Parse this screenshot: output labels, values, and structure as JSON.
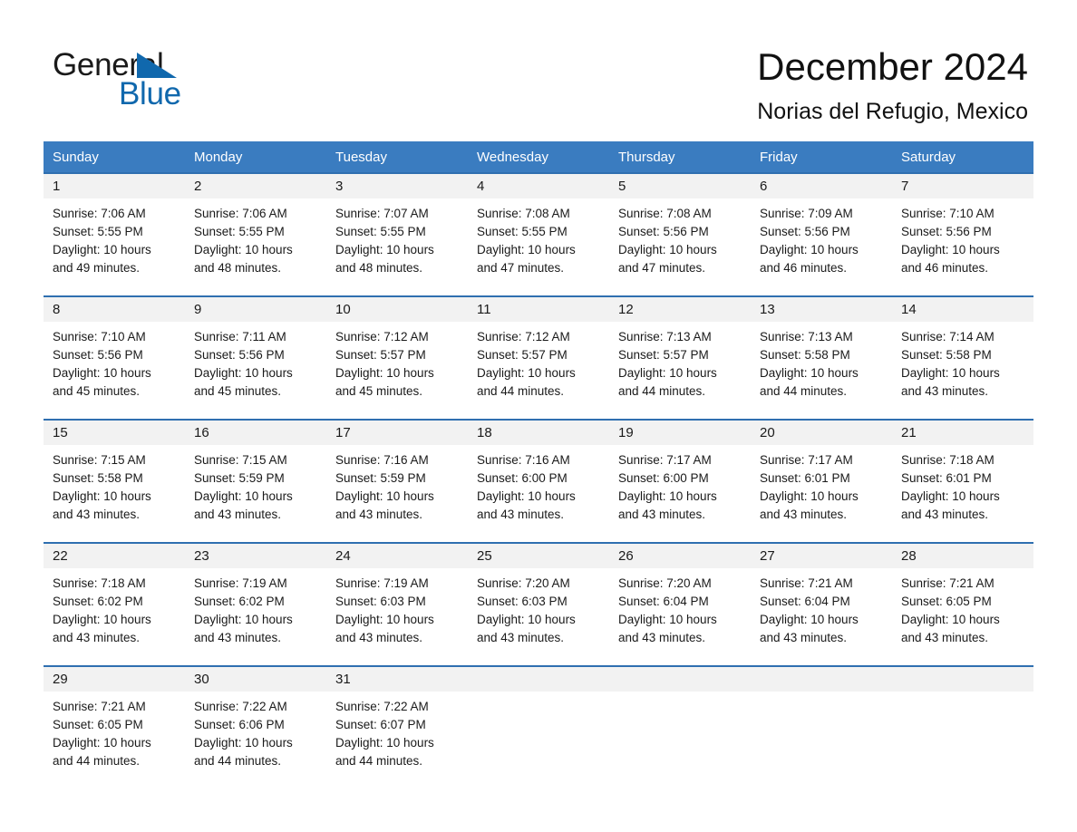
{
  "brand": {
    "name_part1": "General",
    "name_part2": "Blue",
    "triangle_color": "#1068ad",
    "logo_icon": "triangle-flag-icon"
  },
  "header": {
    "title": "December 2024",
    "subtitle": "Norias del Refugio, Mexico"
  },
  "theme": {
    "header_blue": "#3a7cc0",
    "rule_blue": "#2f6fb0",
    "daynum_band": "#f2f2f2",
    "text": "#1a1a1a",
    "page_background": "#ffffff"
  },
  "calendar": {
    "month": "December",
    "year": "2024",
    "weekday_headers": [
      "Sunday",
      "Monday",
      "Tuesday",
      "Wednesday",
      "Thursday",
      "Friday",
      "Saturday"
    ],
    "labels": {
      "sunrise_prefix": "Sunrise:",
      "sunset_prefix": "Sunset:",
      "daylight_prefix": "Daylight:"
    },
    "weeks": [
      [
        {
          "day": "1",
          "sunrise": "Sunrise: 7:06 AM",
          "sunset": "Sunset: 5:55 PM",
          "daylight_line1": "Daylight: 10 hours",
          "daylight_line2": "and 49 minutes."
        },
        {
          "day": "2",
          "sunrise": "Sunrise: 7:06 AM",
          "sunset": "Sunset: 5:55 PM",
          "daylight_line1": "Daylight: 10 hours",
          "daylight_line2": "and 48 minutes."
        },
        {
          "day": "3",
          "sunrise": "Sunrise: 7:07 AM",
          "sunset": "Sunset: 5:55 PM",
          "daylight_line1": "Daylight: 10 hours",
          "daylight_line2": "and 48 minutes."
        },
        {
          "day": "4",
          "sunrise": "Sunrise: 7:08 AM",
          "sunset": "Sunset: 5:55 PM",
          "daylight_line1": "Daylight: 10 hours",
          "daylight_line2": "and 47 minutes."
        },
        {
          "day": "5",
          "sunrise": "Sunrise: 7:08 AM",
          "sunset": "Sunset: 5:56 PM",
          "daylight_line1": "Daylight: 10 hours",
          "daylight_line2": "and 47 minutes."
        },
        {
          "day": "6",
          "sunrise": "Sunrise: 7:09 AM",
          "sunset": "Sunset: 5:56 PM",
          "daylight_line1": "Daylight: 10 hours",
          "daylight_line2": "and 46 minutes."
        },
        {
          "day": "7",
          "sunrise": "Sunrise: 7:10 AM",
          "sunset": "Sunset: 5:56 PM",
          "daylight_line1": "Daylight: 10 hours",
          "daylight_line2": "and 46 minutes."
        }
      ],
      [
        {
          "day": "8",
          "sunrise": "Sunrise: 7:10 AM",
          "sunset": "Sunset: 5:56 PM",
          "daylight_line1": "Daylight: 10 hours",
          "daylight_line2": "and 45 minutes."
        },
        {
          "day": "9",
          "sunrise": "Sunrise: 7:11 AM",
          "sunset": "Sunset: 5:56 PM",
          "daylight_line1": "Daylight: 10 hours",
          "daylight_line2": "and 45 minutes."
        },
        {
          "day": "10",
          "sunrise": "Sunrise: 7:12 AM",
          "sunset": "Sunset: 5:57 PM",
          "daylight_line1": "Daylight: 10 hours",
          "daylight_line2": "and 45 minutes."
        },
        {
          "day": "11",
          "sunrise": "Sunrise: 7:12 AM",
          "sunset": "Sunset: 5:57 PM",
          "daylight_line1": "Daylight: 10 hours",
          "daylight_line2": "and 44 minutes."
        },
        {
          "day": "12",
          "sunrise": "Sunrise: 7:13 AM",
          "sunset": "Sunset: 5:57 PM",
          "daylight_line1": "Daylight: 10 hours",
          "daylight_line2": "and 44 minutes."
        },
        {
          "day": "13",
          "sunrise": "Sunrise: 7:13 AM",
          "sunset": "Sunset: 5:58 PM",
          "daylight_line1": "Daylight: 10 hours",
          "daylight_line2": "and 44 minutes."
        },
        {
          "day": "14",
          "sunrise": "Sunrise: 7:14 AM",
          "sunset": "Sunset: 5:58 PM",
          "daylight_line1": "Daylight: 10 hours",
          "daylight_line2": "and 43 minutes."
        }
      ],
      [
        {
          "day": "15",
          "sunrise": "Sunrise: 7:15 AM",
          "sunset": "Sunset: 5:58 PM",
          "daylight_line1": "Daylight: 10 hours",
          "daylight_line2": "and 43 minutes."
        },
        {
          "day": "16",
          "sunrise": "Sunrise: 7:15 AM",
          "sunset": "Sunset: 5:59 PM",
          "daylight_line1": "Daylight: 10 hours",
          "daylight_line2": "and 43 minutes."
        },
        {
          "day": "17",
          "sunrise": "Sunrise: 7:16 AM",
          "sunset": "Sunset: 5:59 PM",
          "daylight_line1": "Daylight: 10 hours",
          "daylight_line2": "and 43 minutes."
        },
        {
          "day": "18",
          "sunrise": "Sunrise: 7:16 AM",
          "sunset": "Sunset: 6:00 PM",
          "daylight_line1": "Daylight: 10 hours",
          "daylight_line2": "and 43 minutes."
        },
        {
          "day": "19",
          "sunrise": "Sunrise: 7:17 AM",
          "sunset": "Sunset: 6:00 PM",
          "daylight_line1": "Daylight: 10 hours",
          "daylight_line2": "and 43 minutes."
        },
        {
          "day": "20",
          "sunrise": "Sunrise: 7:17 AM",
          "sunset": "Sunset: 6:01 PM",
          "daylight_line1": "Daylight: 10 hours",
          "daylight_line2": "and 43 minutes."
        },
        {
          "day": "21",
          "sunrise": "Sunrise: 7:18 AM",
          "sunset": "Sunset: 6:01 PM",
          "daylight_line1": "Daylight: 10 hours",
          "daylight_line2": "and 43 minutes."
        }
      ],
      [
        {
          "day": "22",
          "sunrise": "Sunrise: 7:18 AM",
          "sunset": "Sunset: 6:02 PM",
          "daylight_line1": "Daylight: 10 hours",
          "daylight_line2": "and 43 minutes."
        },
        {
          "day": "23",
          "sunrise": "Sunrise: 7:19 AM",
          "sunset": "Sunset: 6:02 PM",
          "daylight_line1": "Daylight: 10 hours",
          "daylight_line2": "and 43 minutes."
        },
        {
          "day": "24",
          "sunrise": "Sunrise: 7:19 AM",
          "sunset": "Sunset: 6:03 PM",
          "daylight_line1": "Daylight: 10 hours",
          "daylight_line2": "and 43 minutes."
        },
        {
          "day": "25",
          "sunrise": "Sunrise: 7:20 AM",
          "sunset": "Sunset: 6:03 PM",
          "daylight_line1": "Daylight: 10 hours",
          "daylight_line2": "and 43 minutes."
        },
        {
          "day": "26",
          "sunrise": "Sunrise: 7:20 AM",
          "sunset": "Sunset: 6:04 PM",
          "daylight_line1": "Daylight: 10 hours",
          "daylight_line2": "and 43 minutes."
        },
        {
          "day": "27",
          "sunrise": "Sunrise: 7:21 AM",
          "sunset": "Sunset: 6:04 PM",
          "daylight_line1": "Daylight: 10 hours",
          "daylight_line2": "and 43 minutes."
        },
        {
          "day": "28",
          "sunrise": "Sunrise: 7:21 AM",
          "sunset": "Sunset: 6:05 PM",
          "daylight_line1": "Daylight: 10 hours",
          "daylight_line2": "and 43 minutes."
        }
      ],
      [
        {
          "day": "29",
          "sunrise": "Sunrise: 7:21 AM",
          "sunset": "Sunset: 6:05 PM",
          "daylight_line1": "Daylight: 10 hours",
          "daylight_line2": "and 44 minutes."
        },
        {
          "day": "30",
          "sunrise": "Sunrise: 7:22 AM",
          "sunset": "Sunset: 6:06 PM",
          "daylight_line1": "Daylight: 10 hours",
          "daylight_line2": "and 44 minutes."
        },
        {
          "day": "31",
          "sunrise": "Sunrise: 7:22 AM",
          "sunset": "Sunset: 6:07 PM",
          "daylight_line1": "Daylight: 10 hours",
          "daylight_line2": "and 44 minutes."
        },
        {
          "day": "",
          "sunrise": "",
          "sunset": "",
          "daylight_line1": "",
          "daylight_line2": ""
        },
        {
          "day": "",
          "sunrise": "",
          "sunset": "",
          "daylight_line1": "",
          "daylight_line2": ""
        },
        {
          "day": "",
          "sunrise": "",
          "sunset": "",
          "daylight_line1": "",
          "daylight_line2": ""
        },
        {
          "day": "",
          "sunrise": "",
          "sunset": "",
          "daylight_line1": "",
          "daylight_line2": ""
        }
      ]
    ]
  }
}
